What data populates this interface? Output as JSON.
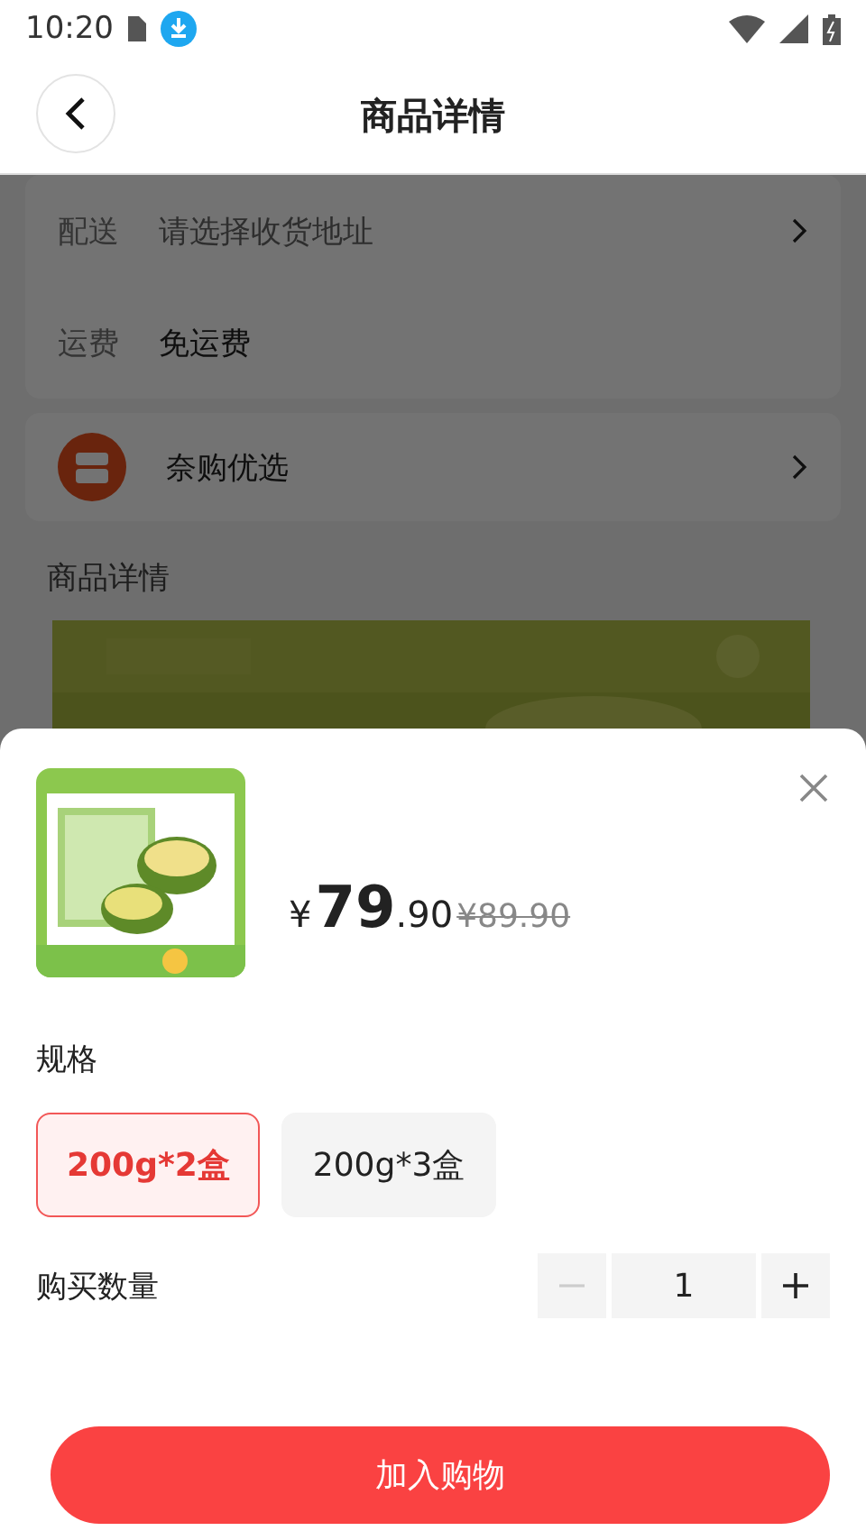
{
  "status_bar": {
    "time": "10:20"
  },
  "header": {
    "title": "商品详情"
  },
  "background_rows": [
    {
      "kind": "field",
      "label": "配送",
      "value": "请选择收货地址",
      "placeholder_style": true,
      "chevron": true
    },
    {
      "kind": "field",
      "label": "运费",
      "value": "免运费",
      "placeholder_style": false,
      "chevron": false
    },
    {
      "kind": "shop",
      "value": "奈购优选",
      "chevron": true
    }
  ],
  "detail_section": {
    "title": "商品详情"
  },
  "sheet": {
    "price_symbol": "¥",
    "price_integer": "79",
    "price_decimal": ".90",
    "original_price": "¥89.90",
    "spec_label": "规格",
    "specs": [
      {
        "label": "200g*2盒",
        "selected": true
      },
      {
        "label": "200g*3盒",
        "selected": false
      }
    ],
    "quantity_label": "购买数量",
    "quantity": "1",
    "decrease_disabled": true,
    "add_to_cart": "加入购物"
  }
}
